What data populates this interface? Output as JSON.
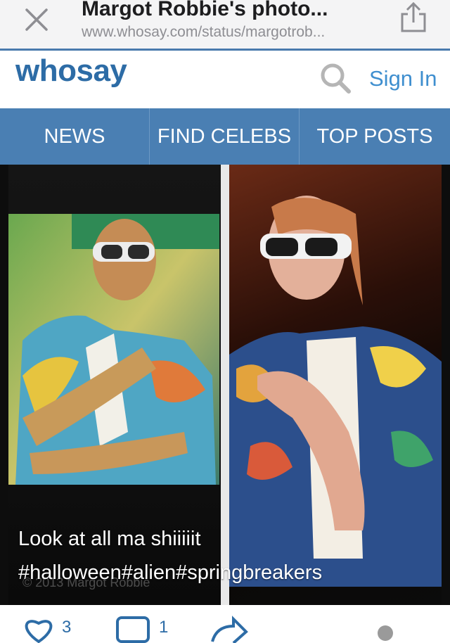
{
  "browser": {
    "title": "Margot Robbie's photo...",
    "url": "www.whosay.com/status/margotrob..."
  },
  "header": {
    "logo": "whosay",
    "signin": "Sign In"
  },
  "nav": {
    "tabs": [
      "NEWS",
      "FIND CELEBS",
      "TOP POSTS"
    ]
  },
  "post": {
    "caption_line1": "Look at all ma shiiiiit",
    "caption_line2": "#halloween#alien#springbreakers",
    "watermark": "© 2013 Margot Robbie"
  },
  "actions": {
    "like_count": "3",
    "comment_count": "1"
  },
  "colors": {
    "brand_blue": "#2d6ca6",
    "nav_blue": "#4a7fb3"
  }
}
